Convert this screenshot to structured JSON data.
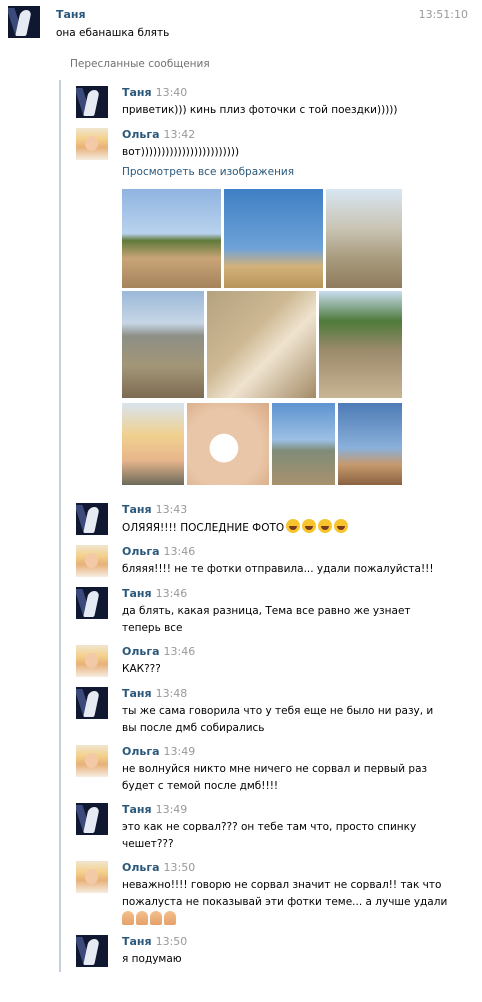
{
  "main_message": {
    "author": "Таня",
    "text": "она ебанашка блять",
    "time": "13:51:10"
  },
  "forwarded_label": "Пересланные сообщения",
  "view_all_images": "Просмотреть все изображения",
  "forwarded": [
    {
      "author": "Таня",
      "time": "13:40",
      "lines": [
        "приветик))) кинь плиз фоточки с той поездки)))))"
      ]
    },
    {
      "author": "Ольга",
      "time": "13:42",
      "lines": [
        "вот))))))))))))))))))))))))"
      ]
    },
    {
      "author": "Таня",
      "time": "13:43",
      "lines": [
        "ОЛЯЯЯ!!!! ПОСЛЕДНИЕ ФОТО"
      ]
    },
    {
      "author": "Ольга",
      "time": "13:46",
      "lines": [
        "бляяя!!!! не те фотки отправила... удали пожалуйста!!!"
      ]
    },
    {
      "author": "Таня",
      "time": "13:46",
      "lines": [
        "да блять, какая разница, Тема все равно же узнает",
        "теперь все"
      ]
    },
    {
      "author": "Ольга",
      "time": "13:46",
      "lines": [
        "КАК???"
      ]
    },
    {
      "author": "Таня",
      "time": "13:48",
      "lines": [
        "ты же сама говорила что у тебя еще не было ни разу, и",
        "вы после дмб собирались"
      ]
    },
    {
      "author": "Ольга",
      "time": "13:49",
      "lines": [
        "не волнуйся никто мне ничего не сорвал и первый раз",
        "будет с темой после дмб!!!!"
      ]
    },
    {
      "author": "Таня",
      "time": "13:49",
      "lines": [
        "это как не сорвал??? он тебе там что, просто спинку",
        "чешет???"
      ]
    },
    {
      "author": "Ольга",
      "time": "13:50",
      "lines": [
        "неважно!!!! говорю не сорвал значит не сорвал!! так что",
        "пожалуста не показывай эти фотки теме... а лучше удали"
      ]
    },
    {
      "author": "Таня",
      "time": "13:50",
      "lines": [
        "я подумаю"
      ]
    }
  ],
  "icons": {
    "laugh": "face-with-tears-of-joy-icon",
    "pray": "folded-hands-icon"
  },
  "colors": {
    "author_name": "#2b587a",
    "time": "#999999",
    "forward_bar": "#c5d0dc",
    "link": "#2b587a"
  }
}
